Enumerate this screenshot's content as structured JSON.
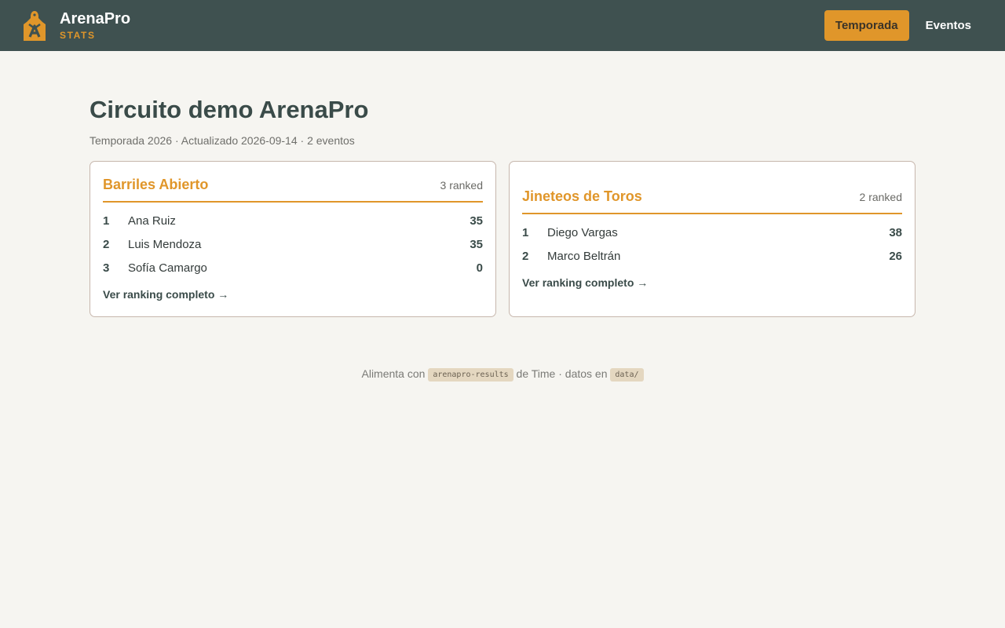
{
  "header": {
    "brand_name": "ArenaPro",
    "brand_sub": "STATS",
    "logo_icon": "arena-tag-logo",
    "nav": [
      {
        "label": "Temporada",
        "active": true
      },
      {
        "label": "Eventos",
        "active": false
      }
    ]
  },
  "main": {
    "title": "Circuito demo ArenaPro",
    "meta": "Temporada 2026 · Actualizado 2026-09-14 · 2 eventos"
  },
  "cards": [
    {
      "title": "Barriles Abierto",
      "count": "3 ranked",
      "rows": [
        {
          "rank": "1",
          "name": "Ana Ruiz",
          "points": "35"
        },
        {
          "rank": "2",
          "name": "Luis Mendoza",
          "points": "35"
        },
        {
          "rank": "3",
          "name": "Sofía Camargo",
          "points": "0"
        }
      ],
      "link": "Ver ranking completo →"
    },
    {
      "title": "Jineteos de Toros",
      "count": "2 ranked",
      "rows": [
        {
          "rank": "1",
          "name": "Diego Vargas",
          "points": "38"
        },
        {
          "rank": "2",
          "name": "Marco Beltrán",
          "points": "26"
        }
      ],
      "link": "Ver ranking completo →"
    }
  ],
  "footer": {
    "prefix": "Alimenta con",
    "code1": "arenapro-results",
    "middle": "de Time · datos en",
    "code2": "data/"
  },
  "colors": {
    "header_bg": "#3f5150",
    "accent": "#e0962a",
    "page_bg": "#f6f5f1"
  }
}
